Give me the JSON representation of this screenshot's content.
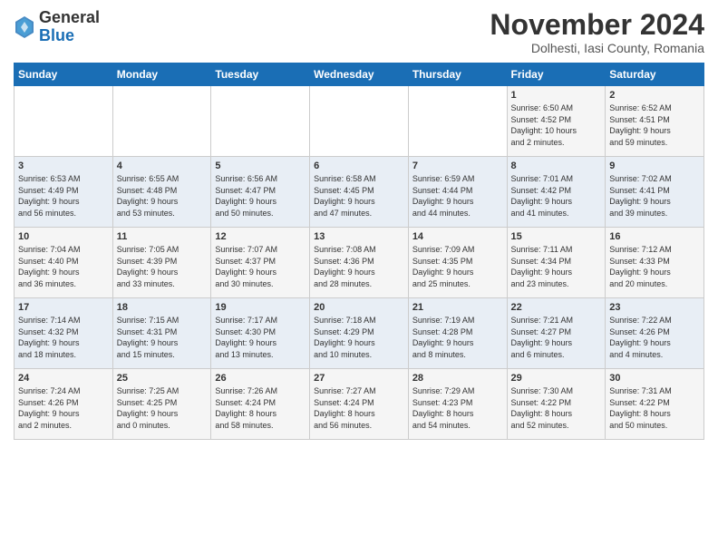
{
  "logo": {
    "general": "General",
    "blue": "Blue"
  },
  "title": "November 2024",
  "location": "Dolhesti, Iasi County, Romania",
  "headers": [
    "Sunday",
    "Monday",
    "Tuesday",
    "Wednesday",
    "Thursday",
    "Friday",
    "Saturday"
  ],
  "rows": [
    [
      {
        "day": "",
        "info": ""
      },
      {
        "day": "",
        "info": ""
      },
      {
        "day": "",
        "info": ""
      },
      {
        "day": "",
        "info": ""
      },
      {
        "day": "",
        "info": ""
      },
      {
        "day": "1",
        "info": "Sunrise: 6:50 AM\nSunset: 4:52 PM\nDaylight: 10 hours\nand 2 minutes."
      },
      {
        "day": "2",
        "info": "Sunrise: 6:52 AM\nSunset: 4:51 PM\nDaylight: 9 hours\nand 59 minutes."
      }
    ],
    [
      {
        "day": "3",
        "info": "Sunrise: 6:53 AM\nSunset: 4:49 PM\nDaylight: 9 hours\nand 56 minutes."
      },
      {
        "day": "4",
        "info": "Sunrise: 6:55 AM\nSunset: 4:48 PM\nDaylight: 9 hours\nand 53 minutes."
      },
      {
        "day": "5",
        "info": "Sunrise: 6:56 AM\nSunset: 4:47 PM\nDaylight: 9 hours\nand 50 minutes."
      },
      {
        "day": "6",
        "info": "Sunrise: 6:58 AM\nSunset: 4:45 PM\nDaylight: 9 hours\nand 47 minutes."
      },
      {
        "day": "7",
        "info": "Sunrise: 6:59 AM\nSunset: 4:44 PM\nDaylight: 9 hours\nand 44 minutes."
      },
      {
        "day": "8",
        "info": "Sunrise: 7:01 AM\nSunset: 4:42 PM\nDaylight: 9 hours\nand 41 minutes."
      },
      {
        "day": "9",
        "info": "Sunrise: 7:02 AM\nSunset: 4:41 PM\nDaylight: 9 hours\nand 39 minutes."
      }
    ],
    [
      {
        "day": "10",
        "info": "Sunrise: 7:04 AM\nSunset: 4:40 PM\nDaylight: 9 hours\nand 36 minutes."
      },
      {
        "day": "11",
        "info": "Sunrise: 7:05 AM\nSunset: 4:39 PM\nDaylight: 9 hours\nand 33 minutes."
      },
      {
        "day": "12",
        "info": "Sunrise: 7:07 AM\nSunset: 4:37 PM\nDaylight: 9 hours\nand 30 minutes."
      },
      {
        "day": "13",
        "info": "Sunrise: 7:08 AM\nSunset: 4:36 PM\nDaylight: 9 hours\nand 28 minutes."
      },
      {
        "day": "14",
        "info": "Sunrise: 7:09 AM\nSunset: 4:35 PM\nDaylight: 9 hours\nand 25 minutes."
      },
      {
        "day": "15",
        "info": "Sunrise: 7:11 AM\nSunset: 4:34 PM\nDaylight: 9 hours\nand 23 minutes."
      },
      {
        "day": "16",
        "info": "Sunrise: 7:12 AM\nSunset: 4:33 PM\nDaylight: 9 hours\nand 20 minutes."
      }
    ],
    [
      {
        "day": "17",
        "info": "Sunrise: 7:14 AM\nSunset: 4:32 PM\nDaylight: 9 hours\nand 18 minutes."
      },
      {
        "day": "18",
        "info": "Sunrise: 7:15 AM\nSunset: 4:31 PM\nDaylight: 9 hours\nand 15 minutes."
      },
      {
        "day": "19",
        "info": "Sunrise: 7:17 AM\nSunset: 4:30 PM\nDaylight: 9 hours\nand 13 minutes."
      },
      {
        "day": "20",
        "info": "Sunrise: 7:18 AM\nSunset: 4:29 PM\nDaylight: 9 hours\nand 10 minutes."
      },
      {
        "day": "21",
        "info": "Sunrise: 7:19 AM\nSunset: 4:28 PM\nDaylight: 9 hours\nand 8 minutes."
      },
      {
        "day": "22",
        "info": "Sunrise: 7:21 AM\nSunset: 4:27 PM\nDaylight: 9 hours\nand 6 minutes."
      },
      {
        "day": "23",
        "info": "Sunrise: 7:22 AM\nSunset: 4:26 PM\nDaylight: 9 hours\nand 4 minutes."
      }
    ],
    [
      {
        "day": "24",
        "info": "Sunrise: 7:24 AM\nSunset: 4:26 PM\nDaylight: 9 hours\nand 2 minutes."
      },
      {
        "day": "25",
        "info": "Sunrise: 7:25 AM\nSunset: 4:25 PM\nDaylight: 9 hours\nand 0 minutes."
      },
      {
        "day": "26",
        "info": "Sunrise: 7:26 AM\nSunset: 4:24 PM\nDaylight: 8 hours\nand 58 minutes."
      },
      {
        "day": "27",
        "info": "Sunrise: 7:27 AM\nSunset: 4:24 PM\nDaylight: 8 hours\nand 56 minutes."
      },
      {
        "day": "28",
        "info": "Sunrise: 7:29 AM\nSunset: 4:23 PM\nDaylight: 8 hours\nand 54 minutes."
      },
      {
        "day": "29",
        "info": "Sunrise: 7:30 AM\nSunset: 4:22 PM\nDaylight: 8 hours\nand 52 minutes."
      },
      {
        "day": "30",
        "info": "Sunrise: 7:31 AM\nSunset: 4:22 PM\nDaylight: 8 hours\nand 50 minutes."
      }
    ]
  ]
}
